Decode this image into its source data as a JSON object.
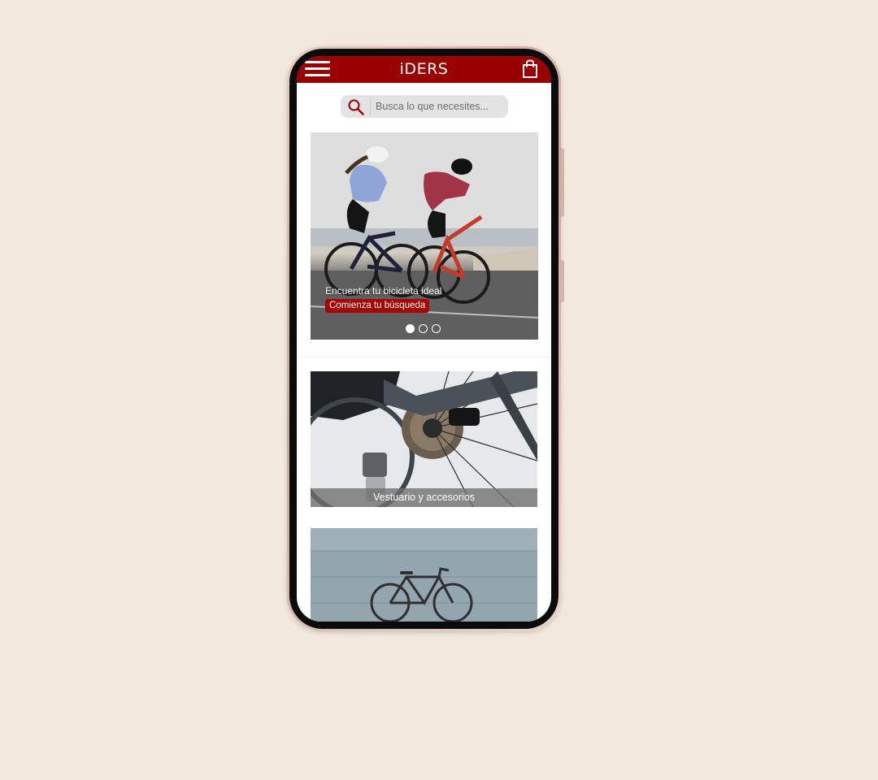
{
  "header": {
    "title": "iDERS",
    "menu_icon": "hamburger-menu-icon",
    "cart_icon": "shopping-bag-icon",
    "brand_color": "#9b0000"
  },
  "search": {
    "placeholder": "Busca lo que necesites...",
    "value": "",
    "icon": "search-icon"
  },
  "hero": {
    "caption": "Encuentra tu bicicleta ideal",
    "cta_label": "Comienza tu búsqueda",
    "slides_total": 3,
    "active_slide": 1,
    "cta_color": "#a60000"
  },
  "categories": [
    {
      "label": "Vestuario y accesorios"
    },
    {
      "label": ""
    }
  ],
  "colors": {
    "background": "#f2e8de",
    "accent": "#9b0000"
  }
}
